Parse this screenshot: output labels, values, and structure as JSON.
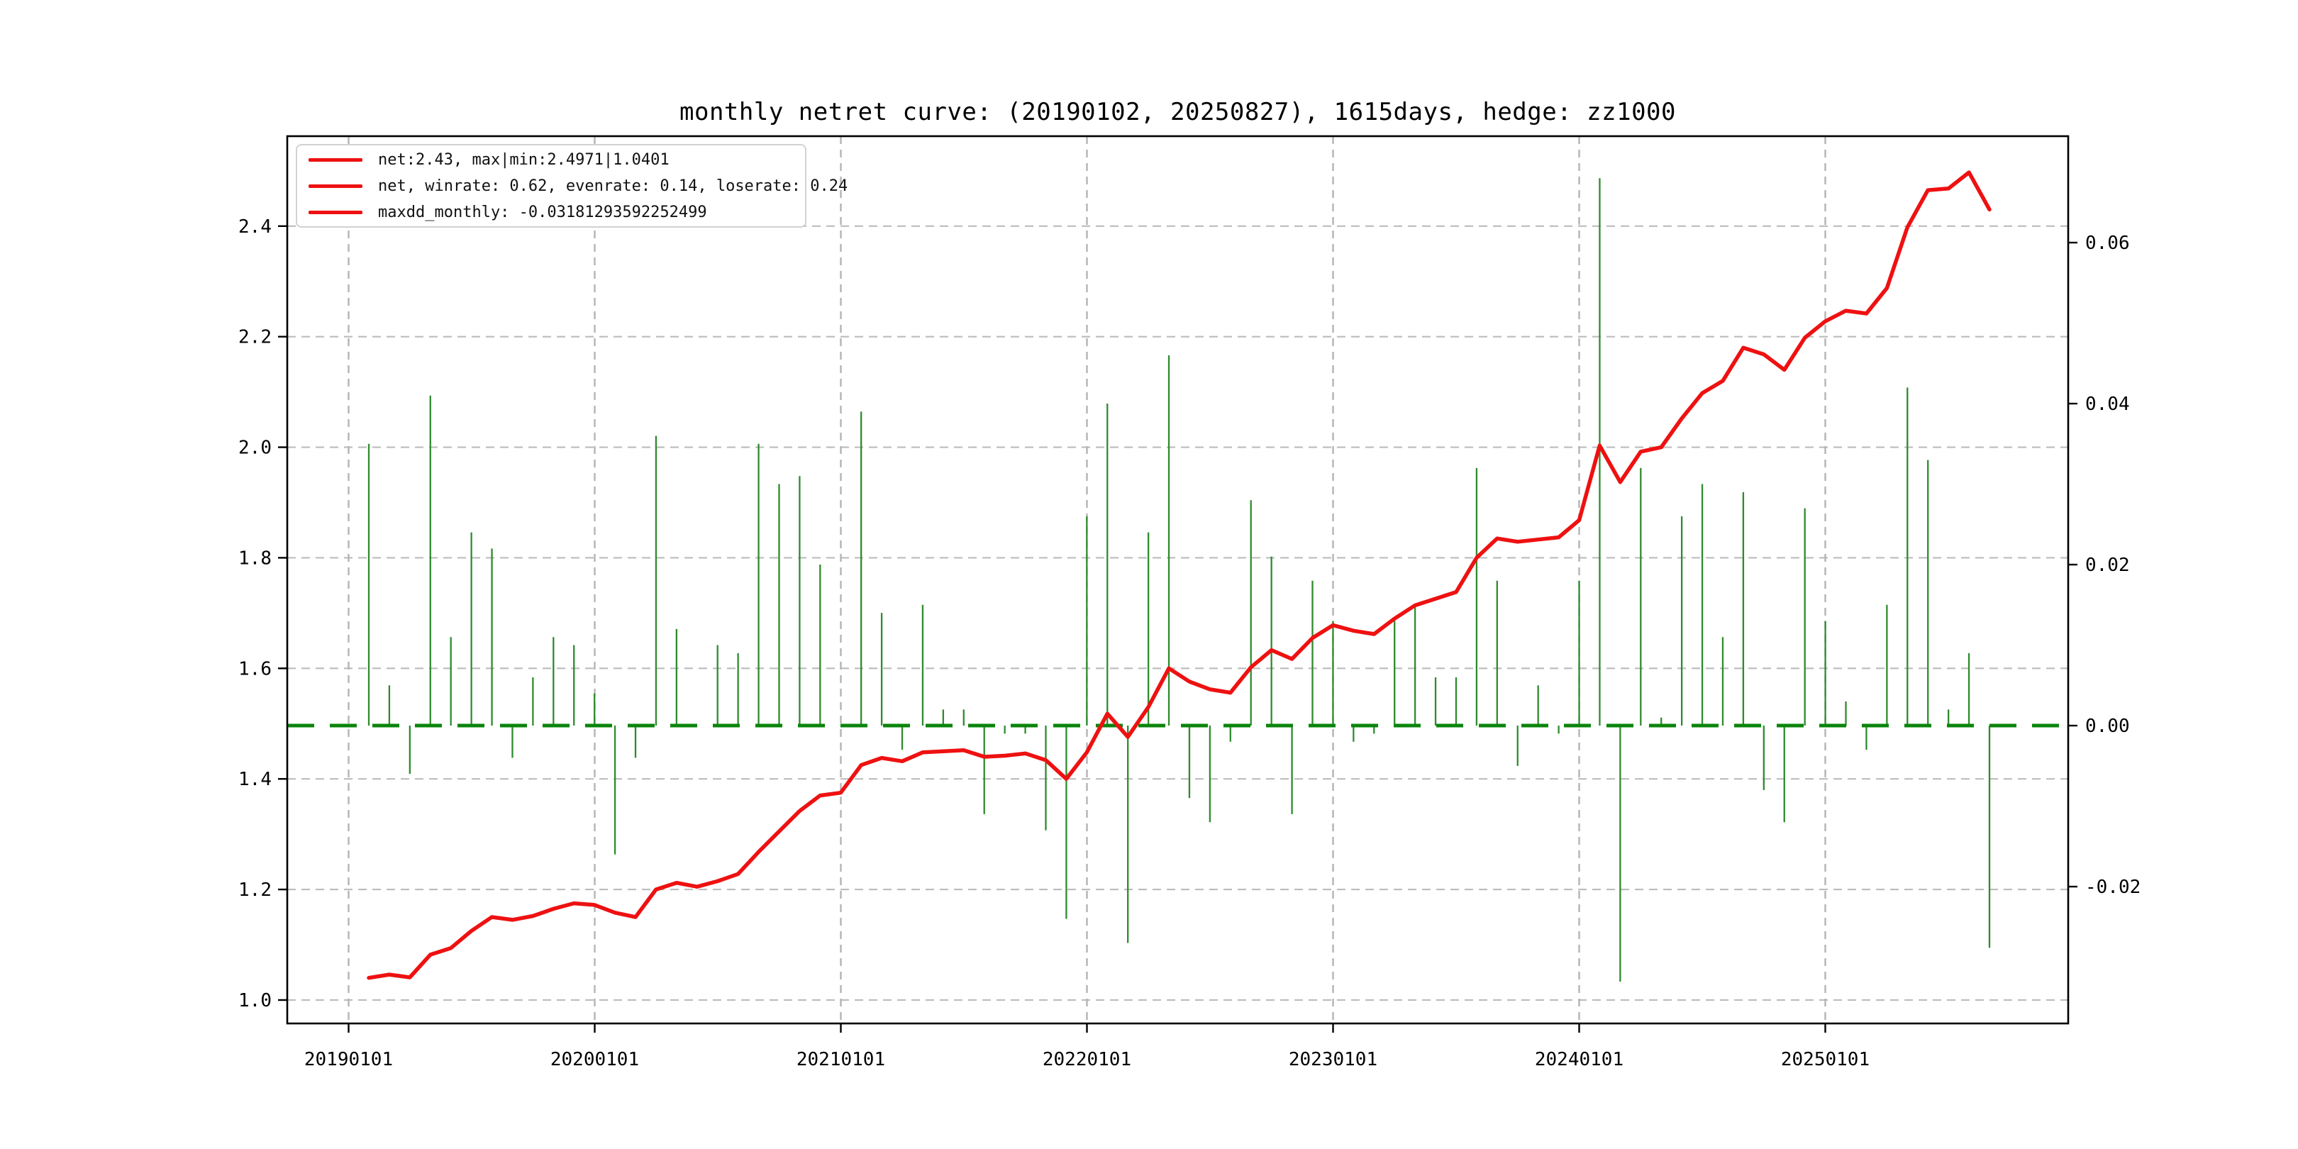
{
  "chart": {
    "title": "monthly netret curve: (20190102, 20250827), 1615days, hedge: zz1000",
    "legend": {
      "items": [
        {
          "label": "net:2.43, max|min:2.4971|1.0401",
          "color": "#ee1111",
          "marker": "red-line"
        },
        {
          "label": "net, winrate: 0.62, evenrate: 0.14, loserate: 0.24",
          "color": "#ee1111",
          "marker": "red-line"
        },
        {
          "label": "maxdd_monthly: -0.03181293592252499",
          "color": "#ee1111",
          "marker": "red-line"
        }
      ]
    }
  },
  "chart_data": {
    "type": "line+bar",
    "title": "monthly netret curve: (20190102, 20250827), 1615days, hedge: zz1000",
    "grid": true,
    "legend_position": "upper left",
    "x_axis": {
      "tick_labels": [
        "20190101",
        "20200101",
        "20210101",
        "20220101",
        "20230101",
        "20240101",
        "20250101"
      ]
    },
    "left_axis": {
      "ticks": [
        1.0,
        1.2,
        1.4,
        1.6,
        1.8,
        2.0,
        2.2,
        2.4
      ],
      "labels": [
        "1.0",
        "1.2",
        "1.4",
        "1.6",
        "1.8",
        "2.0",
        "2.2",
        "2.4"
      ],
      "lim": [
        0.9576,
        2.5627
      ]
    },
    "right_axis": {
      "ticks": [
        -0.02,
        0.0,
        0.02,
        0.04,
        0.06
      ],
      "labels": [
        "-0.02",
        "0.00",
        "0.02",
        "0.04",
        "0.06"
      ],
      "lim": [
        -0.037,
        0.07322
      ]
    },
    "zero_line": {
      "axis": "right",
      "value": 0.0,
      "color": "#0a850a",
      "style": "dashed"
    },
    "categories": [
      "201901",
      "201902",
      "201903",
      "201904",
      "201905",
      "201906",
      "201907",
      "201908",
      "201909",
      "201910",
      "201911",
      "201912",
      "202001",
      "202002",
      "202003",
      "202004",
      "202005",
      "202006",
      "202007",
      "202008",
      "202009",
      "202010",
      "202011",
      "202012",
      "202101",
      "202102",
      "202103",
      "202104",
      "202105",
      "202106",
      "202107",
      "202108",
      "202109",
      "202110",
      "202111",
      "202112",
      "202201",
      "202202",
      "202203",
      "202204",
      "202205",
      "202206",
      "202207",
      "202208",
      "202209",
      "202210",
      "202211",
      "202212",
      "202301",
      "202302",
      "202303",
      "202304",
      "202305",
      "202306",
      "202307",
      "202308",
      "202309",
      "202310",
      "202311",
      "202312",
      "202401",
      "202402",
      "202403",
      "202404",
      "202405",
      "202406",
      "202407",
      "202408",
      "202409",
      "202410",
      "202411",
      "202412",
      "202501",
      "202502",
      "202503",
      "202504",
      "202505",
      "202506",
      "202507",
      "202508"
    ],
    "series": [
      {
        "name": "net",
        "type": "line",
        "axis": "left",
        "color": "#ee1111",
        "values": [
          1.0401,
          1.046,
          1.041,
          1.082,
          1.094,
          1.125,
          1.15,
          1.145,
          1.152,
          1.165,
          1.175,
          1.172,
          1.158,
          1.15,
          1.2,
          1.212,
          1.205,
          1.215,
          1.228,
          1.268,
          1.305,
          1.342,
          1.37,
          1.375,
          1.425,
          1.438,
          1.432,
          1.448,
          1.45,
          1.452,
          1.44,
          1.442,
          1.446,
          1.434,
          1.4,
          1.448,
          1.518,
          1.476,
          1.53,
          1.6,
          1.576,
          1.562,
          1.556,
          1.602,
          1.633,
          1.617,
          1.655,
          1.678,
          1.668,
          1.662,
          1.69,
          1.714,
          1.726,
          1.738,
          1.8,
          1.835,
          1.829,
          1.833,
          1.837,
          1.868,
          2.003,
          1.937,
          1.992,
          2.0,
          2.052,
          2.098,
          2.12,
          2.18,
          2.168,
          2.14,
          2.198,
          2.228,
          2.247,
          2.242,
          2.288,
          2.398,
          2.465,
          2.468,
          2.4971,
          2.43
        ]
      },
      {
        "name": "monthly_return",
        "type": "bar",
        "axis": "right",
        "color": "#2e8b2e",
        "values": [
          0.035,
          0.005,
          -0.006,
          0.041,
          0.011,
          0.024,
          0.022,
          -0.004,
          0.006,
          0.011,
          0.01,
          0.004,
          -0.016,
          -0.004,
          0.036,
          0.012,
          0.0,
          0.01,
          0.009,
          0.035,
          0.03,
          0.031,
          0.02,
          0.0,
          0.039,
          0.014,
          -0.003,
          0.015,
          0.002,
          0.002,
          -0.011,
          -0.001,
          -0.001,
          -0.013,
          -0.024,
          0.026,
          0.04,
          -0.027,
          0.024,
          0.046,
          -0.009,
          -0.012,
          -0.002,
          0.028,
          0.021,
          -0.011,
          0.018,
          0.013,
          -0.002,
          -0.001,
          0.013,
          0.015,
          0.006,
          0.006,
          0.032,
          0.018,
          -0.005,
          0.005,
          -0.001,
          0.018,
          0.068,
          -0.0318,
          0.032,
          0.001,
          0.026,
          0.03,
          0.011,
          0.029,
          -0.008,
          -0.012,
          0.027,
          0.013,
          0.003,
          -0.003,
          0.015,
          0.042,
          0.033,
          0.002,
          0.009,
          -0.0276
        ]
      }
    ],
    "stats": {
      "net_final": 2.43,
      "net_max": 2.4971,
      "net_min": 1.0401,
      "winrate": 0.62,
      "evenrate": 0.14,
      "loserate": 0.24,
      "maxdd_monthly": -0.03181293592252499
    },
    "colors": {
      "grid": "#bcbcbc",
      "axis": "#000000",
      "background": "#ffffff"
    }
  }
}
